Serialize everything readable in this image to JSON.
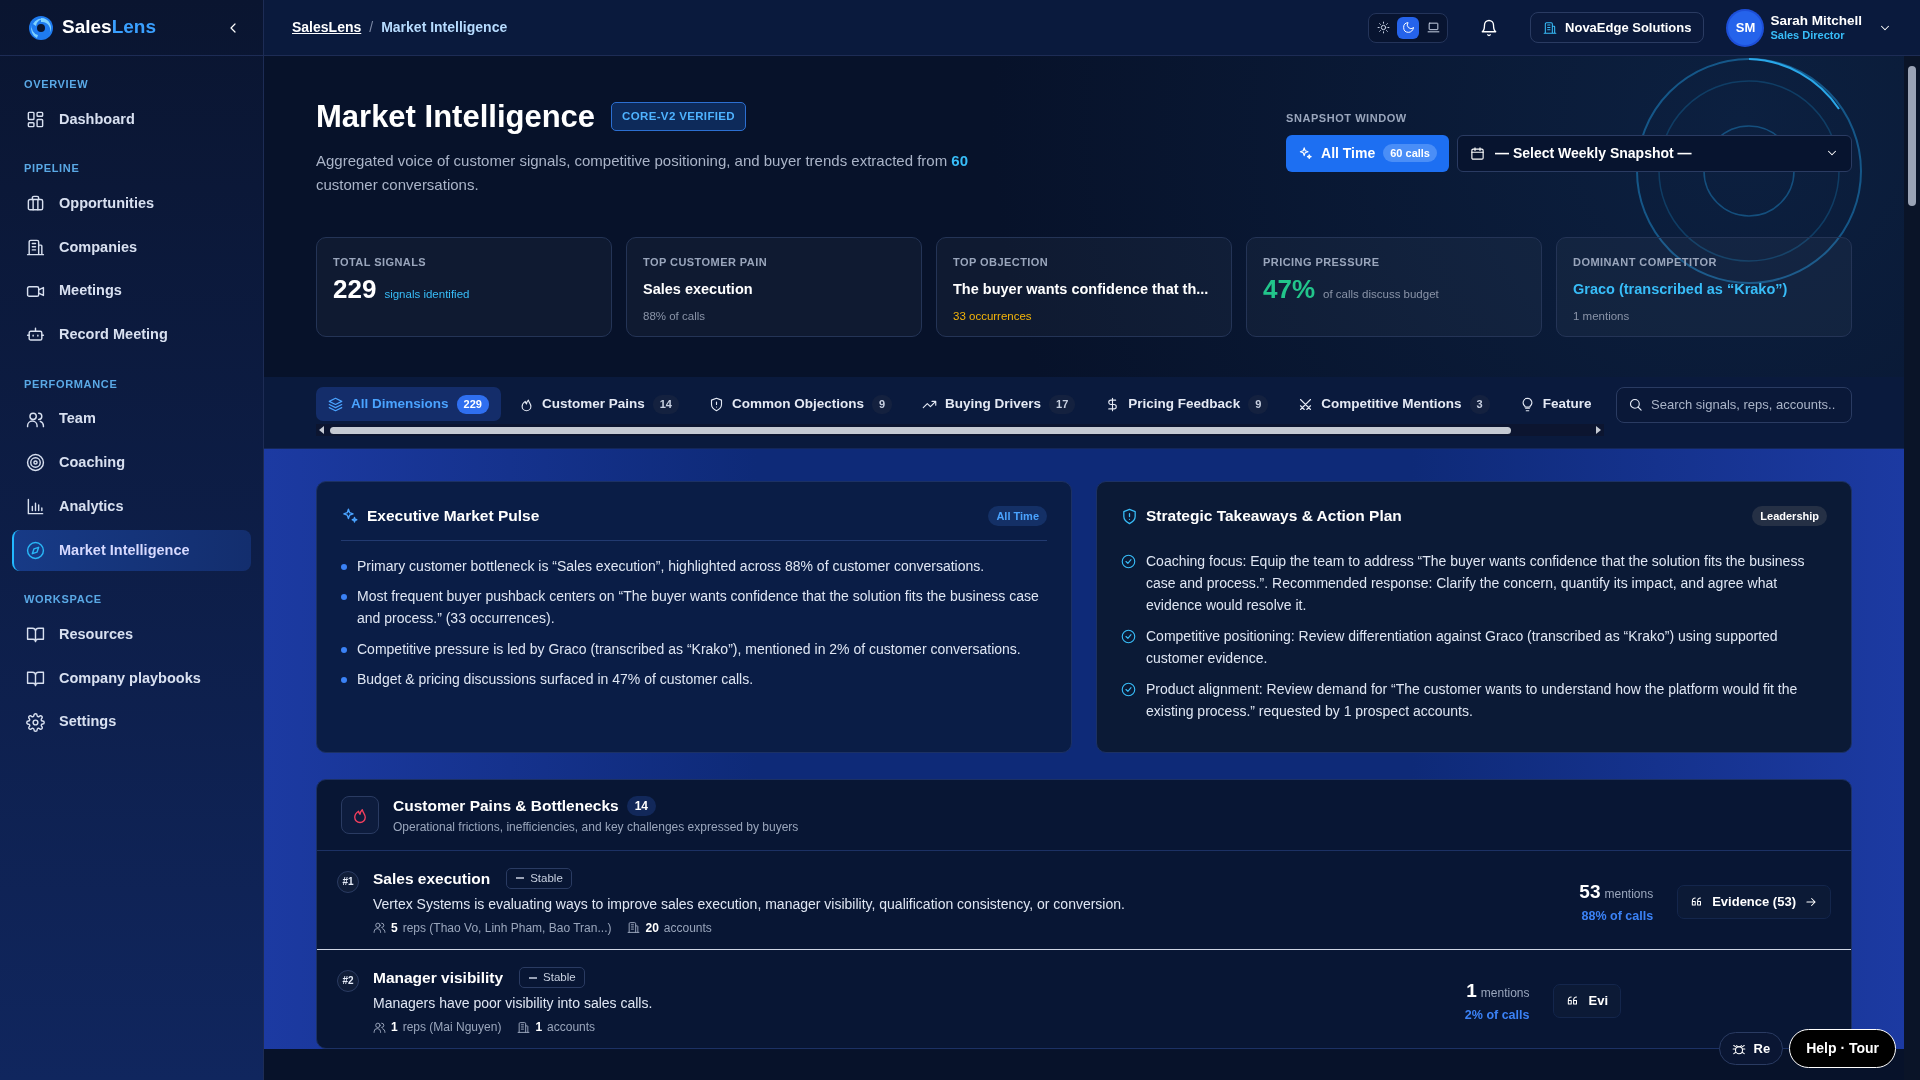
{
  "sidebar": {
    "brand": {
      "first": "Sales",
      "second": "Lens"
    },
    "sections": [
      {
        "title": "OVERVIEW",
        "items": [
          {
            "label": "Dashboard",
            "selected": false
          }
        ]
      },
      {
        "title": "PIPELINE",
        "items": [
          {
            "label": "Opportunities",
            "selected": false
          },
          {
            "label": "Companies",
            "selected": false
          },
          {
            "label": "Meetings",
            "selected": false
          },
          {
            "label": "Record Meeting",
            "selected": false
          }
        ]
      },
      {
        "title": "PERFORMANCE",
        "items": [
          {
            "label": "Team",
            "selected": false
          },
          {
            "label": "Coaching",
            "selected": false
          },
          {
            "label": "Analytics",
            "selected": false
          },
          {
            "label": "Market Intelligence",
            "selected": true
          }
        ]
      },
      {
        "title": "WORKSPACE",
        "items": [
          {
            "label": "Resources",
            "selected": false
          },
          {
            "label": "Company playbooks",
            "selected": false
          },
          {
            "label": "Settings",
            "selected": false
          }
        ]
      }
    ]
  },
  "header": {
    "breadcrumb": [
      "SalesLens",
      "Market Intelligence"
    ],
    "breadcrumb_separator": "/",
    "theme_modes": [
      {
        "selected": false
      },
      {
        "selected": true
      },
      {
        "selected": false
      }
    ],
    "organization": "NovaEdge Solutions",
    "user": {
      "initials": "SM",
      "name": "Sarah Mitchell",
      "role": "Sales Director"
    }
  },
  "page": {
    "title": "Market Intelligence",
    "badge": "CORE-V2 VERIFIED",
    "description": "Aggregated voice of customer signals, competitive positioning, and buyer trends extracted from **60** customer conversations."
  },
  "snapshot": {
    "label": "SNAPSHOT WINDOW",
    "all_time": {
      "label": "All Time",
      "count": "60 calls",
      "selected": true
    },
    "select": "— Select Weekly Snapshot —"
  },
  "kpis": [
    {
      "kind": "stat",
      "label": "TOTAL SIGNALS",
      "value": {
        "text": "229",
        "color": "#ffffff"
      },
      "note": {
        "text": "signals identified",
        "color": "#38bdf8"
      }
    },
    {
      "kind": "headline",
      "label": "TOP CUSTOMER PAIN",
      "value": {
        "text": "Sales execution",
        "color": "#ffffff"
      },
      "note": {
        "text": "88% of calls",
        "color": "#8a94a8"
      }
    },
    {
      "kind": "headline",
      "label": "TOP OBJECTION",
      "value": {
        "text": "The buyer wants confidence that th...",
        "color": "#ffffff"
      },
      "note": {
        "text": "33 occurrences",
        "color": "#f5b50a"
      }
    },
    {
      "kind": "stat",
      "label": "PRICING PRESSURE",
      "value": {
        "text": "47%",
        "color": "#22c58b"
      },
      "note": {
        "text": "of calls discuss budget",
        "color": "#8a94a8"
      }
    },
    {
      "kind": "headline",
      "label": "DOMINANT COMPETITOR",
      "value": {
        "text": "Graco (transcribed as “Krako”)",
        "color": "#38bdf8"
      },
      "note": {
        "text": "1 mentions",
        "color": "#8a94a8"
      }
    }
  ],
  "tabs": [
    {
      "label": "All Dimensions",
      "count": "229",
      "selected": true
    },
    {
      "label": "Customer Pains",
      "count": "14",
      "selected": false
    },
    {
      "label": "Common Objections",
      "count": "9",
      "selected": false
    },
    {
      "label": "Buying Drivers",
      "count": "17",
      "selected": false
    },
    {
      "label": "Pricing Feedback",
      "count": "9",
      "selected": false
    },
    {
      "label": "Competitive Mentions",
      "count": "3",
      "selected": false
    },
    {
      "label": "Feature",
      "selected": false
    }
  ],
  "search": {
    "placeholder": "Search signals, reps, accounts.."
  },
  "pulse": {
    "title": "Executive Market Pulse",
    "tag": "All Time",
    "bullets": [
      "Primary customer bottleneck is “Sales execution”, highlighted across 88% of customer conversations.",
      "Most frequent buyer pushback centers on “The buyer wants confidence that the solution fits the business case and process.” (33 occurrences).",
      "Competitive pressure is led by Graco (transcribed as “Krako”), mentioned in 2% of customer conversations.",
      "Budget & pricing discussions surfaced in 47% of customer calls."
    ]
  },
  "takeaways": {
    "title": "Strategic Takeaways & Action Plan",
    "tag": "Leadership",
    "items": [
      "Coaching focus: Equip the team to address “The buyer wants confidence that the solution fits the business case and process.”. Recommended response: Clarify the concern, quantify its impact, and agree what evidence would resolve it.",
      "Competitive positioning: Review differentiation against Graco (transcribed as “Krako”) using supported customer evidence.",
      "Product alignment: Review demand for “The customer wants to understand how the platform would fit the existing process.” requested by 1 prospect accounts."
    ]
  },
  "pains": {
    "title": "Customer Pains & Bottlenecks",
    "count": "14",
    "subtitle": "Operational frictions, inefficiencies, and key challenges expressed by buyers",
    "rows": [
      {
        "rank": "#1",
        "title": "Sales execution",
        "trend": "Stable",
        "description": "Vertex Systems is evaluating ways to improve sales execution, manager visibility, qualification consistency, or conversion.",
        "reps_count": "5",
        "reps_text": "reps (Thao Vo, Linh Pham, Bao Tran...)",
        "accounts_count": "20",
        "accounts_text": "accounts",
        "mentions": "53",
        "mentions_label": "mentions",
        "share": "88% of calls",
        "evidence": "Evidence (53)"
      },
      {
        "rank": "#2",
        "title": "Manager visibility",
        "trend": "Stable",
        "description": "Managers have poor visibility into sales calls.",
        "reps_count": "1",
        "reps_text": "reps (Mai Nguyen)",
        "accounts_count": "1",
        "accounts_text": "accounts",
        "mentions": "1",
        "mentions_label": "mentions",
        "share": "2% of calls",
        "evidence": "Evi"
      }
    ]
  },
  "floating": {
    "report": "Re",
    "help": "Help · Tour"
  }
}
